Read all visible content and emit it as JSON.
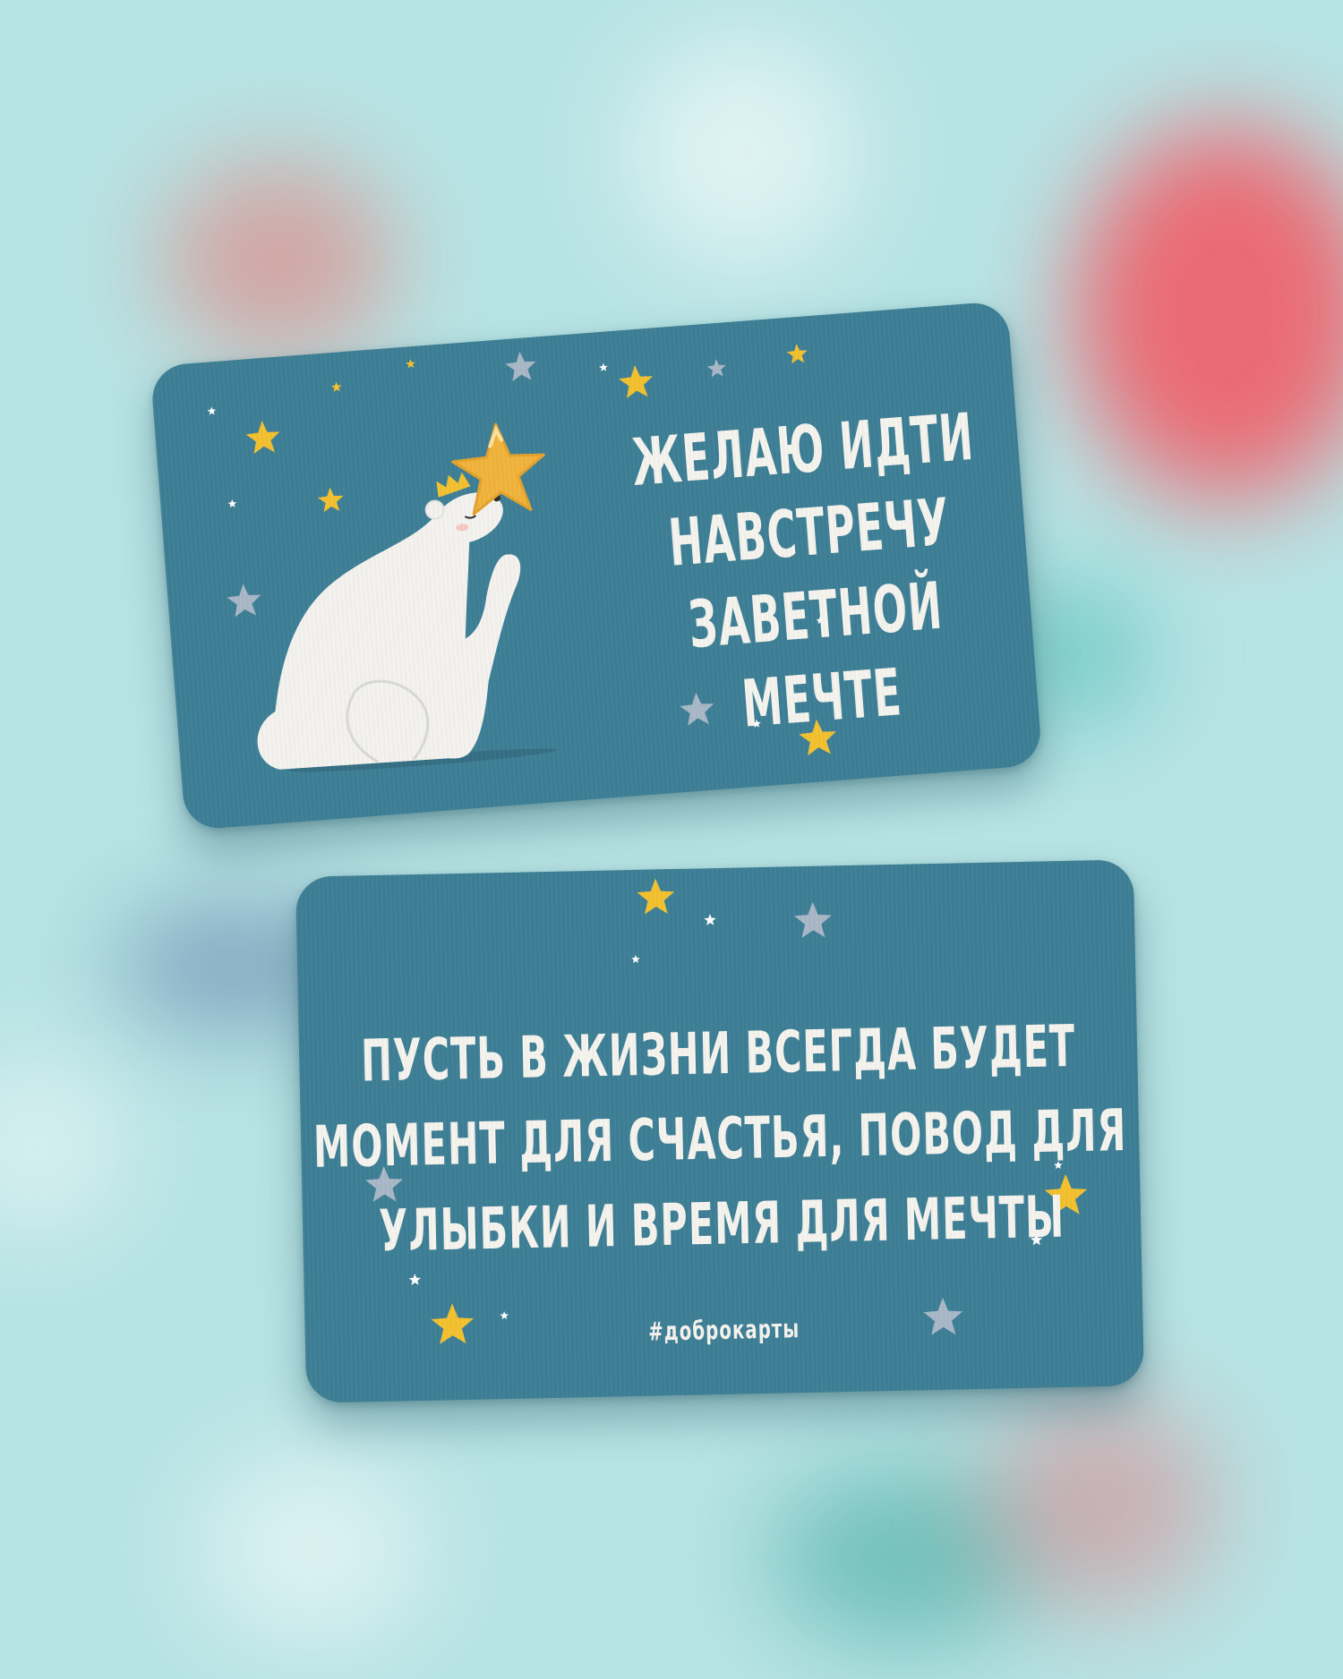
{
  "front_card": {
    "text": "Желаю идти навстречу заветной мечте"
  },
  "back_card": {
    "text": "Пусть в жизни всегда будет момент для счастья, повод для улыбки и время для мечты",
    "hashtag": "#доброкарты"
  },
  "colors": {
    "background": "#b7e3e4",
    "card": "#3e7f96",
    "text": "#f6f4ee",
    "star_yellow": "#f3c230",
    "star_grey": "#a9b8c8",
    "star_white": "#ffffff",
    "bear": "#f4f3ef"
  },
  "icons": [
    "polar-bear-illustration",
    "crown-icon",
    "balloon-star-icon",
    "star-icon"
  ]
}
